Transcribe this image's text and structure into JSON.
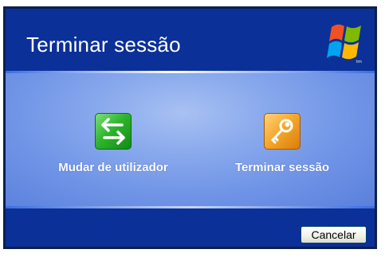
{
  "dialog": {
    "title": "Terminar sessão"
  },
  "options": [
    {
      "label": "Mudar de utilizador",
      "icon": "switch-user-icon"
    },
    {
      "label": "Terminar sessão",
      "icon": "log-off-key-icon"
    }
  ],
  "footer": {
    "cancel_label": "Cancelar"
  },
  "colors": {
    "title_bar": "#0b3098",
    "content_bg": "#8aaaed",
    "switch_icon": "#2fb52e",
    "logoff_icon": "#f4a52a"
  }
}
